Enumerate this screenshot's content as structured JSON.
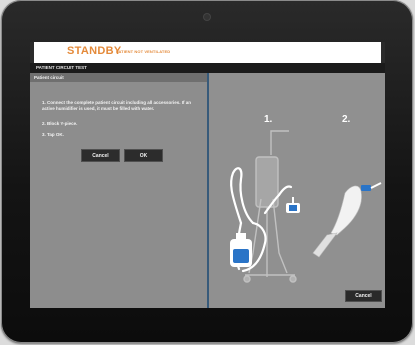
{
  "header": {
    "title": "STANDBY",
    "subtitle": "PATIENT NOT VENTILATED"
  },
  "menubar": {
    "label": "PATIENT CIRCUIT TEST"
  },
  "panel": {
    "heading": "Patient circuit",
    "instructions": [
      "1. Connect the complete patient circuit including all accessories. If an active humidifier is used, it must be filled with water.",
      "2. Block Y-piece.",
      "3. Tap OK."
    ],
    "cancel_label": "Cancel",
    "ok_label": "OK"
  },
  "illustration": {
    "step1": "1.",
    "step2": "2.",
    "cancel_label": "Cancel"
  },
  "colors": {
    "accent": "#e48a3a",
    "panel_bg": "#8d8d8d",
    "button_bg": "#2c2c2c",
    "divider": "#375a7a"
  }
}
